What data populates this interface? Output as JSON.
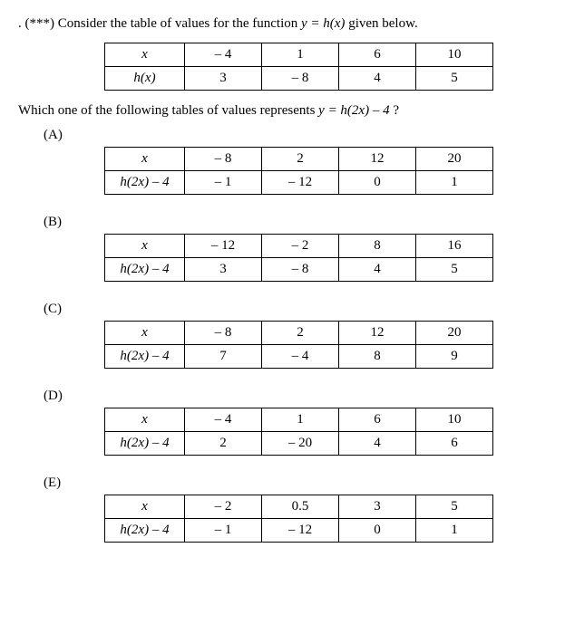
{
  "question_prefix": ". (***) Consider the table of values for the function ",
  "question_fn": "y = h(x)",
  "question_suffix": " given below.",
  "prompt_prefix": "Which one of the following tables of values represents ",
  "prompt_fn": "y = h(2x) – 4",
  "prompt_suffix": "?",
  "base_table": {
    "row1_header": "x",
    "row1": [
      "– 4",
      "1",
      "6",
      "10"
    ],
    "row2_header": "h(x)",
    "row2": [
      "3",
      "– 8",
      "4",
      "5"
    ]
  },
  "options": {
    "A": {
      "label": "(A)",
      "row1_header": "x",
      "row1": [
        "– 8",
        "2",
        "12",
        "20"
      ],
      "row2_header": "h(2x) – 4",
      "row2": [
        "– 1",
        "– 12",
        "0",
        "1"
      ]
    },
    "B": {
      "label": "(B)",
      "row1_header": "x",
      "row1": [
        "– 12",
        "– 2",
        "8",
        "16"
      ],
      "row2_header": "h(2x) – 4",
      "row2": [
        "3",
        "– 8",
        "4",
        "5"
      ]
    },
    "C": {
      "label": "(C)",
      "row1_header": "x",
      "row1": [
        "– 8",
        "2",
        "12",
        "20"
      ],
      "row2_header": "h(2x) – 4",
      "row2": [
        "7",
        "– 4",
        "8",
        "9"
      ]
    },
    "D": {
      "label": "(D)",
      "row1_header": "x",
      "row1": [
        "– 4",
        "1",
        "6",
        "10"
      ],
      "row2_header": "h(2x) – 4",
      "row2": [
        "2",
        "– 20",
        "4",
        "6"
      ]
    },
    "E": {
      "label": "(E)",
      "row1_header": "x",
      "row1": [
        "– 2",
        "0.5",
        "3",
        "5"
      ],
      "row2_header": "h(2x) – 4",
      "row2": [
        "– 1",
        "– 12",
        "0",
        "1"
      ]
    }
  },
  "chart_data": [
    {
      "type": "table",
      "name": "base",
      "categories": [
        -4,
        1,
        6,
        10
      ],
      "series": [
        {
          "name": "h(x)",
          "values": [
            3,
            -8,
            4,
            5
          ]
        }
      ]
    },
    {
      "type": "table",
      "name": "A",
      "categories": [
        -8,
        2,
        12,
        20
      ],
      "series": [
        {
          "name": "h(2x)-4",
          "values": [
            -1,
            -12,
            0,
            1
          ]
        }
      ]
    },
    {
      "type": "table",
      "name": "B",
      "categories": [
        -12,
        -2,
        8,
        16
      ],
      "series": [
        {
          "name": "h(2x)-4",
          "values": [
            3,
            -8,
            4,
            5
          ]
        }
      ]
    },
    {
      "type": "table",
      "name": "C",
      "categories": [
        -8,
        2,
        12,
        20
      ],
      "series": [
        {
          "name": "h(2x)-4",
          "values": [
            7,
            -4,
            8,
            9
          ]
        }
      ]
    },
    {
      "type": "table",
      "name": "D",
      "categories": [
        -4,
        1,
        6,
        10
      ],
      "series": [
        {
          "name": "h(2x)-4",
          "values": [
            2,
            -20,
            4,
            6
          ]
        }
      ]
    },
    {
      "type": "table",
      "name": "E",
      "categories": [
        -2,
        0.5,
        3,
        5
      ],
      "series": [
        {
          "name": "h(2x)-4",
          "values": [
            -1,
            -12,
            0,
            1
          ]
        }
      ]
    }
  ]
}
